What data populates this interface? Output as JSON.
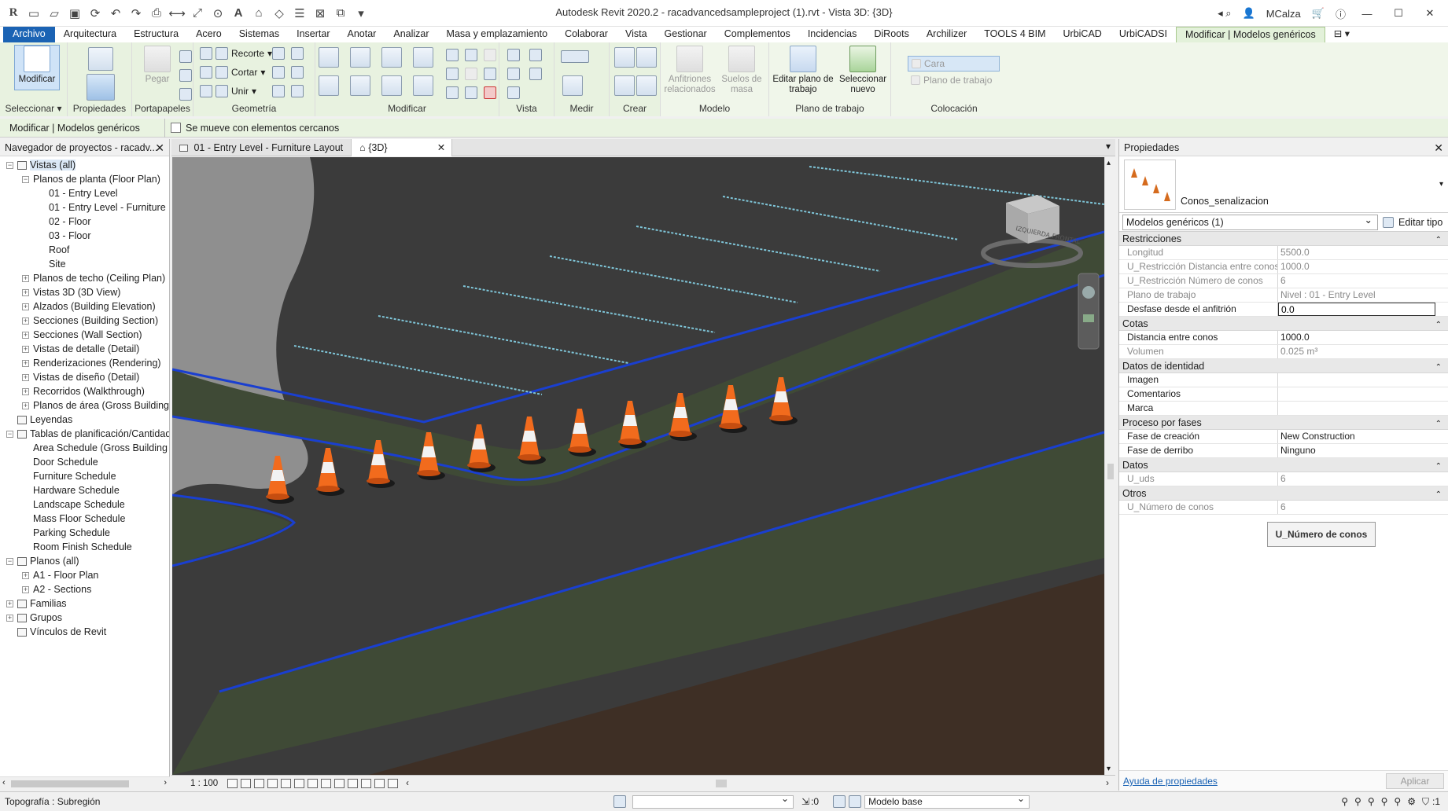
{
  "titlebar": {
    "title": "Autodesk Revit 2020.2 - racadvancedsampleproject (1).rvt - Vista 3D: {3D}",
    "user": "MCalza"
  },
  "tabs": [
    {
      "label": "Archivo"
    },
    {
      "label": "Arquitectura"
    },
    {
      "label": "Estructura"
    },
    {
      "label": "Acero"
    },
    {
      "label": "Sistemas"
    },
    {
      "label": "Insertar"
    },
    {
      "label": "Anotar"
    },
    {
      "label": "Analizar"
    },
    {
      "label": "Masa y emplazamiento"
    },
    {
      "label": "Colaborar"
    },
    {
      "label": "Vista"
    },
    {
      "label": "Gestionar"
    },
    {
      "label": "Complementos"
    },
    {
      "label": "Incidencias"
    },
    {
      "label": "DiRoots"
    },
    {
      "label": "Archilizer"
    },
    {
      "label": "TOOLS 4 BIM"
    },
    {
      "label": "UrbiCAD"
    },
    {
      "label": "UrbiCADSI"
    },
    {
      "label": "Modificar | Modelos genéricos"
    }
  ],
  "ribbon": {
    "modificar": "Modificar",
    "pegar": "Pegar",
    "recorte": "Recorte",
    "cortar": "Cortar",
    "unir": "Unir",
    "anfitriones": "Anfitriones relacionados",
    "suelos": "Suelos de masa",
    "editar_plano": "Editar plano de trabajo",
    "seleccionar_nuevo": "Seleccionar nuevo",
    "cara": "Cara",
    "plano_trabajo_btn": "Plano de trabajo",
    "panels": {
      "seleccionar": "Seleccionar ▾",
      "propiedades": "Propiedades",
      "portapapeles": "Portapapeles",
      "geometria": "Geometría",
      "modificar": "Modificar",
      "vista": "Vista",
      "medir": "Medir",
      "crear": "Crear",
      "modelo": "Modelo",
      "plano_trabajo": "Plano de trabajo",
      "colocacion": "Colocación"
    }
  },
  "optbar": {
    "context": "Modificar | Modelos genéricos",
    "checkbox_label": "Se mueve con elementos cercanos"
  },
  "browser": {
    "title": "Navegador de proyectos - racadv...",
    "nodes": [
      {
        "label": "Vistas (all)",
        "level": 0,
        "exp": "−"
      },
      {
        "label": "Planos de planta (Floor Plan)",
        "level": 1,
        "exp": "−"
      },
      {
        "label": "01 - Entry Level",
        "level": 2,
        "exp": ""
      },
      {
        "label": "01 - Entry Level - Furniture",
        "level": 2,
        "exp": ""
      },
      {
        "label": "02 - Floor",
        "level": 2,
        "exp": ""
      },
      {
        "label": "03 - Floor",
        "level": 2,
        "exp": ""
      },
      {
        "label": "Roof",
        "level": 2,
        "exp": ""
      },
      {
        "label": "Site",
        "level": 2,
        "exp": ""
      },
      {
        "label": "Planos de techo (Ceiling Plan)",
        "level": 1,
        "exp": "+"
      },
      {
        "label": "Vistas 3D (3D View)",
        "level": 1,
        "exp": "+"
      },
      {
        "label": "Alzados (Building Elevation)",
        "level": 1,
        "exp": "+"
      },
      {
        "label": "Secciones (Building Section)",
        "level": 1,
        "exp": "+"
      },
      {
        "label": "Secciones (Wall Section)",
        "level": 1,
        "exp": "+"
      },
      {
        "label": "Vistas de detalle (Detail)",
        "level": 1,
        "exp": "+"
      },
      {
        "label": "Renderizaciones (Rendering)",
        "level": 1,
        "exp": "+"
      },
      {
        "label": "Vistas de diseño (Detail)",
        "level": 1,
        "exp": "+"
      },
      {
        "label": "Recorridos (Walkthrough)",
        "level": 1,
        "exp": "+"
      },
      {
        "label": "Planos de área (Gross Building",
        "level": 1,
        "exp": "+"
      },
      {
        "label": "Leyendas",
        "level": 0,
        "exp": ""
      },
      {
        "label": "Tablas de planificación/Cantidad",
        "level": 0,
        "exp": "−"
      },
      {
        "label": "Area Schedule (Gross Building",
        "level": 1,
        "exp": ""
      },
      {
        "label": "Door Schedule",
        "level": 1,
        "exp": ""
      },
      {
        "label": "Furniture Schedule",
        "level": 1,
        "exp": ""
      },
      {
        "label": "Hardware Schedule",
        "level": 1,
        "exp": ""
      },
      {
        "label": "Landscape Schedule",
        "level": 1,
        "exp": ""
      },
      {
        "label": "Mass Floor Schedule",
        "level": 1,
        "exp": ""
      },
      {
        "label": "Parking Schedule",
        "level": 1,
        "exp": ""
      },
      {
        "label": "Room Finish Schedule",
        "level": 1,
        "exp": ""
      },
      {
        "label": "Planos (all)",
        "level": 0,
        "exp": "−"
      },
      {
        "label": "A1 - Floor Plan",
        "level": 1,
        "exp": "+"
      },
      {
        "label": "A2 - Sections",
        "level": 1,
        "exp": "+"
      },
      {
        "label": "Familias",
        "level": 0,
        "exp": "+"
      },
      {
        "label": "Grupos",
        "level": 0,
        "exp": "+"
      },
      {
        "label": "Vínculos de Revit",
        "level": 0,
        "exp": ""
      }
    ]
  },
  "viewtabs": [
    {
      "label": "01 - Entry Level - Furniture Layout"
    },
    {
      "label": "{3D}"
    }
  ],
  "viewctrl": {
    "scale": "1 : 100"
  },
  "viewcube": {
    "label": "IZQUIERDA FRONTAL"
  },
  "properties": {
    "title": "Propiedades",
    "type_name": "Conos_senalizacion",
    "instance_selector": "Modelos genéricos (1)",
    "edit_type": "Editar tipo",
    "groups": [
      {
        "name": "Restricciones",
        "rows": [
          {
            "label": "Longitud",
            "value": "5500.0",
            "ro": true
          },
          {
            "label": "U_Restricción Distancia entre conos",
            "value": "1000.0",
            "ro": true
          },
          {
            "label": "U_Restricción Número de conos",
            "value": "6",
            "ro": true
          },
          {
            "label": "Plano de trabajo",
            "value": "Nivel : 01 - Entry Level",
            "ro": true
          },
          {
            "label": "Desfase desde el anfitrión",
            "value": "0.0",
            "ro": false,
            "editing": true
          }
        ]
      },
      {
        "name": "Cotas",
        "rows": [
          {
            "label": "Distancia entre conos",
            "value": "1000.0",
            "ro": false
          },
          {
            "label": "Volumen",
            "value": "0.025 m³",
            "ro": true
          }
        ]
      },
      {
        "name": "Datos de identidad",
        "rows": [
          {
            "label": "Imagen",
            "value": "",
            "ro": false
          },
          {
            "label": "Comentarios",
            "value": "",
            "ro": false
          },
          {
            "label": "Marca",
            "value": "",
            "ro": false
          }
        ]
      },
      {
        "name": "Proceso por fases",
        "rows": [
          {
            "label": "Fase de creación",
            "value": "New Construction",
            "ro": false
          },
          {
            "label": "Fase de derribo",
            "value": "Ninguno",
            "ro": false
          }
        ]
      },
      {
        "name": "Datos",
        "rows": [
          {
            "label": "U_uds",
            "value": "6",
            "ro": true
          }
        ]
      },
      {
        "name": "Otros",
        "rows": [
          {
            "label": "U_Número de conos",
            "value": "6",
            "ro": true
          }
        ]
      }
    ],
    "calc_button": "U_Número de conos",
    "help_link": "Ayuda de propiedades",
    "apply": "Aplicar"
  },
  "status": {
    "message": "Topografía : Subregión",
    "zero": ":0",
    "model": "Modelo base",
    "filter": ":1"
  },
  "colors": {
    "accent": "#1b63b4",
    "ribbon_context": "#e8f2e0",
    "cone_orange": "#f26b1d",
    "road": "#3b3b3b",
    "grass": "#3f4a36",
    "boundary_blue": "#1a3fd0"
  }
}
